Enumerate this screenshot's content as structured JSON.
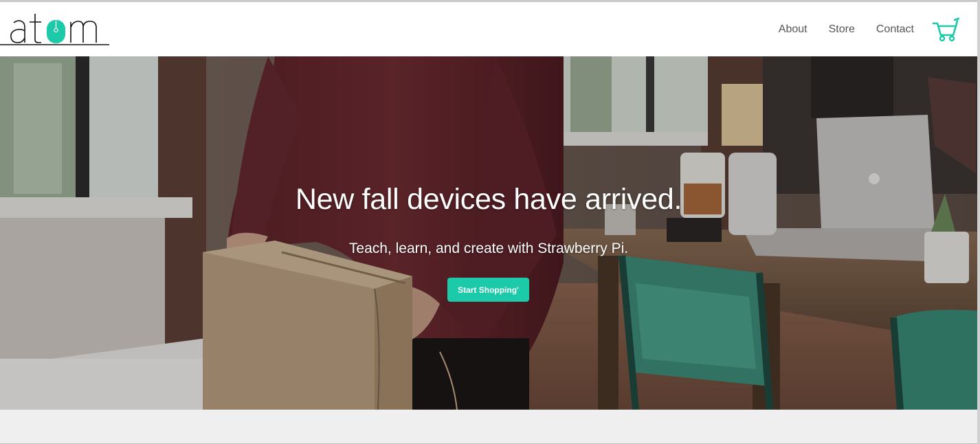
{
  "brand": {
    "logo_text": "atom",
    "accent_color": "#1ccaa9"
  },
  "nav": {
    "items": [
      {
        "label": "About"
      },
      {
        "label": "Store"
      },
      {
        "label": "Contact"
      }
    ],
    "cart_icon": "shopping-cart-icon"
  },
  "hero": {
    "title": "New fall devices have arrived.",
    "subtitle": "Teach, learn, and create with Strawberry Pi.",
    "cta_label": "Start Shopping'",
    "cta_color": "#1ccaa9"
  }
}
